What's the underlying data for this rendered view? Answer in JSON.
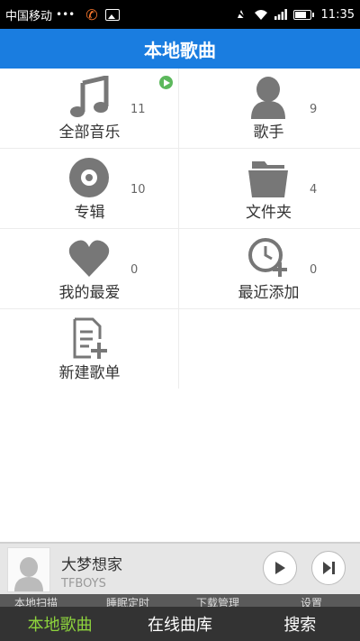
{
  "status_bar": {
    "carrier": "中国移动",
    "dots": "•••",
    "time": "11:35"
  },
  "title": "本地歌曲",
  "categories": [
    {
      "label": "全部音乐",
      "count": "11",
      "icon": "music-note-icon"
    },
    {
      "label": "歌手",
      "count": "9",
      "icon": "singer-icon"
    },
    {
      "label": "专辑",
      "count": "10",
      "icon": "album-disc-icon"
    },
    {
      "label": "文件夹",
      "count": "4",
      "icon": "folder-icon"
    },
    {
      "label": "我的最爱",
      "count": "0",
      "icon": "heart-icon"
    },
    {
      "label": "最近添加",
      "count": "0",
      "icon": "clock-add-icon"
    },
    {
      "label": "新建歌单",
      "count": "",
      "icon": "new-playlist-icon"
    }
  ],
  "player": {
    "song": "大梦想家",
    "artist": "TFBOYS"
  },
  "toolbar": [
    "本地扫描",
    "睡眠定时",
    "下载管理",
    "设置"
  ],
  "tabs": [
    "本地歌曲",
    "在线曲库",
    "搜索"
  ],
  "colors": {
    "accent": "#1a7de0",
    "active_tab": "#8ed43d",
    "icon_gray": "#777777",
    "badge": "#5cb85c"
  }
}
